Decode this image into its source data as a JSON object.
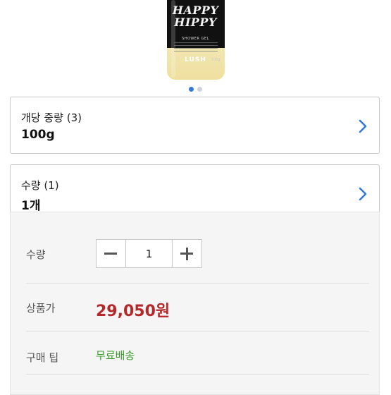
{
  "product": {
    "bottle_title": "HAPPY\nHIPPY",
    "bottle_subtitle": "SHOWER GEL",
    "bottle_brand": "LUSH",
    "bottle_weight": "100g"
  },
  "carousel": {
    "pages": 2,
    "active": 1
  },
  "options": [
    {
      "label": "개당 중량 (3)",
      "value": "100g"
    },
    {
      "label": "수량 (1)",
      "value": "1개"
    }
  ],
  "details": {
    "quantity_label": "수량",
    "quantity_value": "1",
    "price_label": "상품가",
    "price_value": "29,050원",
    "tip_label": "구매 팁",
    "tip_value": "무료배송"
  },
  "colors": {
    "accent": "#3479d6",
    "price": "#b5282b",
    "tip": "#3a9a2c"
  }
}
